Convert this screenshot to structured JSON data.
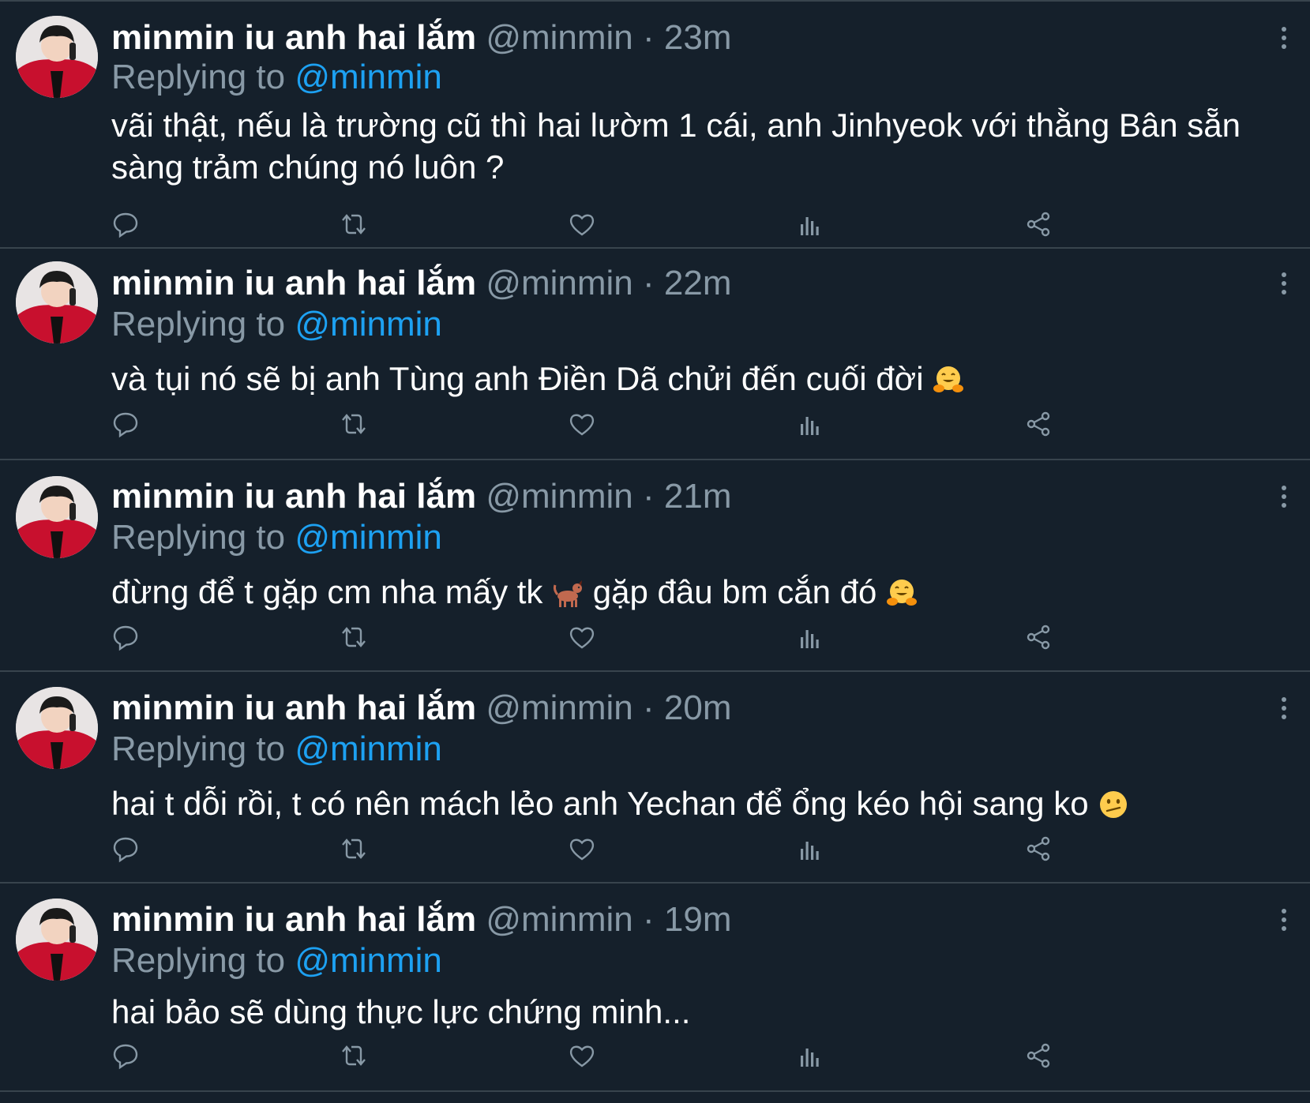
{
  "tweets": [
    {
      "display_name": "minmin iu anh hai lắm",
      "handle": "@minmin",
      "separator": "·",
      "time": "23m",
      "reply_prefix": "Replying to",
      "reply_handle": "@minmin",
      "text": "vãi thật, nếu là trường cũ thì hai lườm 1 cái, anh Jinhyeok với thằng Bân sẵn sàng trảm chúng nó luôn ?"
    },
    {
      "display_name": "minmin iu anh hai lắm",
      "handle": "@minmin",
      "separator": "·",
      "time": "22m",
      "reply_prefix": "Replying to",
      "reply_handle": "@minmin",
      "text": "và tụi nó sẽ bị anh Tùng anh Điền Dã chửi đến cuối đời",
      "emoji_end": "hugging-face-emoji"
    },
    {
      "display_name": "minmin iu anh hai lắm",
      "handle": "@minmin",
      "separator": "·",
      "time": "21m",
      "reply_prefix": "Replying to",
      "reply_handle": "@minmin",
      "text_a": "đừng để t gặp cm nha mấy tk",
      "emoji_mid": "dog-emoji",
      "text_b": "gặp đâu bm cắn đó",
      "emoji_end": "hugging-face-emoji"
    },
    {
      "display_name": "minmin iu anh hai lắm",
      "handle": "@minmin",
      "separator": "·",
      "time": "20m",
      "reply_prefix": "Replying to",
      "reply_handle": "@minmin",
      "text": "hai t dỗi rồi, t có nên mách lẻo anh Yechan để ổng kéo hội sang ko",
      "emoji_end": "confused-face-emoji"
    },
    {
      "display_name": "minmin iu anh hai lắm",
      "handle": "@minmin",
      "separator": "·",
      "time": "19m",
      "reply_prefix": "Replying to",
      "reply_handle": "@minmin",
      "text": "hai bảo sẽ dùng thực lực chứng minh..."
    }
  ],
  "actions": [
    "reply-icon",
    "retweet-icon",
    "like-icon",
    "analytics-icon",
    "share-icon"
  ],
  "colors": {
    "background": "#15202b",
    "divider": "#38444d",
    "secondary_text": "#8899a6",
    "accent": "#1da1f2",
    "primary_text": "#ffffff"
  }
}
